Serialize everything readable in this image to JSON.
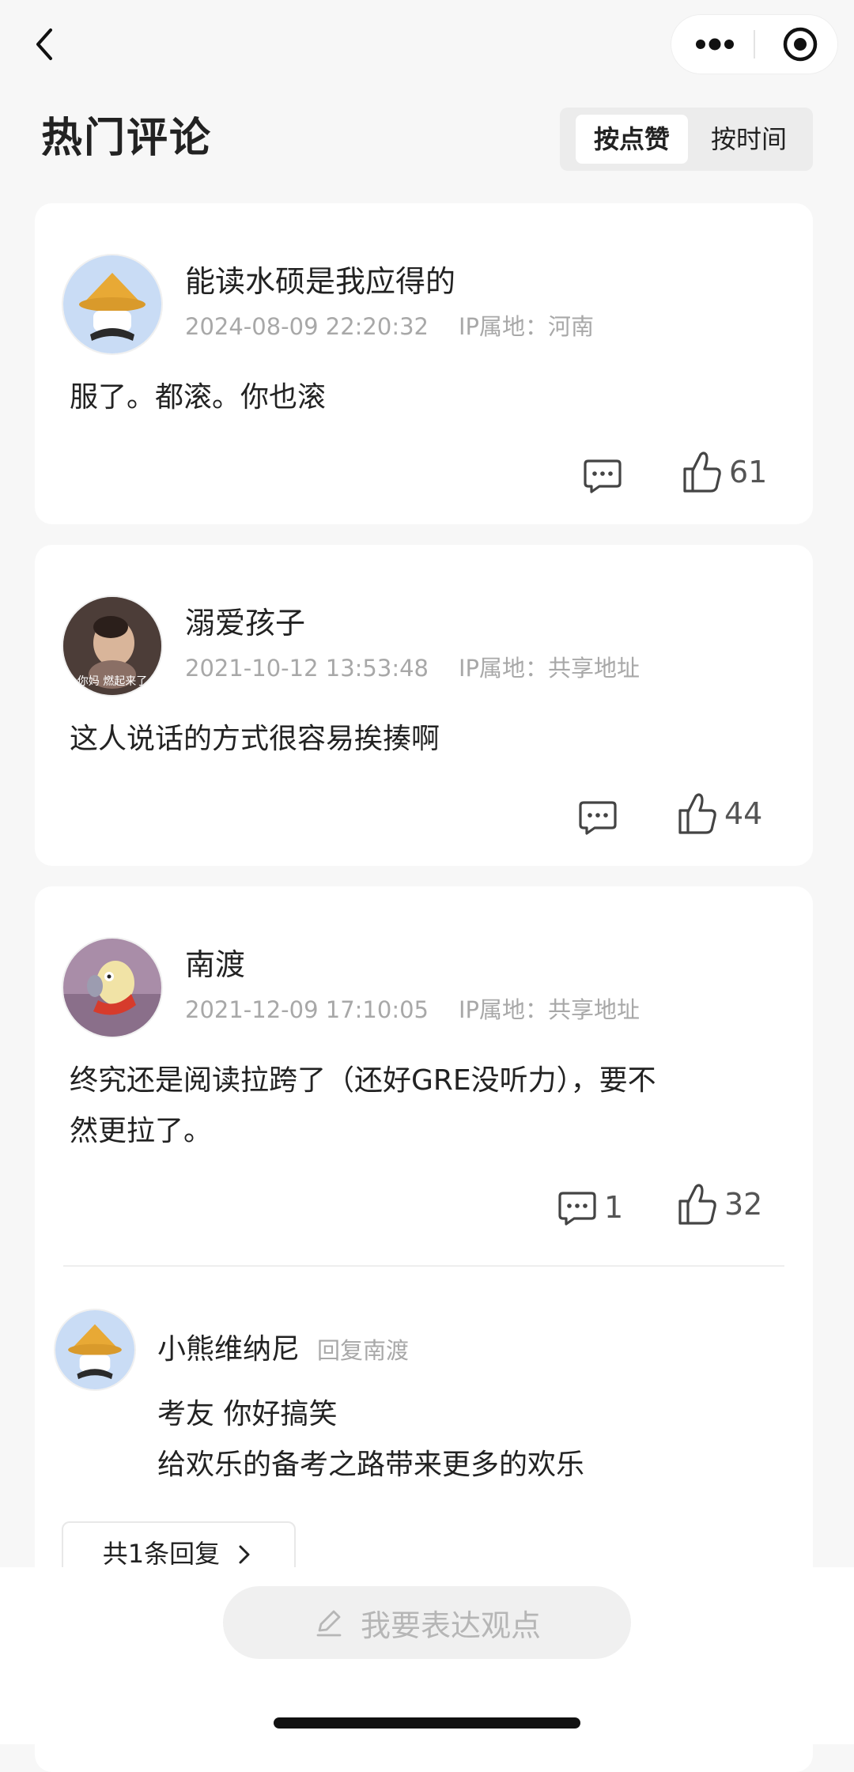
{
  "header": {
    "back_icon": "chevron-left-icon",
    "more_icon": "more-dots-icon",
    "close_icon": "target-close-icon"
  },
  "title": "热门评论",
  "sort": {
    "by_likes": "按点赞",
    "by_time": "按时间",
    "selected": "按点赞"
  },
  "comments": [
    {
      "user": "能读水硕是我应得的",
      "time": "2024-08-09 22:20:32",
      "ip": "IP属地：河南",
      "text": "服了。都滚。你也滚",
      "likes": "61",
      "replies": ""
    },
    {
      "user": "溺爱孩子",
      "time": "2021-10-12 13:53:48",
      "ip": "IP属地：共享地址",
      "text": "这人说话的方式很容易挨揍啊",
      "likes": "44",
      "replies": "",
      "avatar_caption": "你妈 燃起来了"
    },
    {
      "user": "南渡",
      "time": "2021-12-09 17:10:05",
      "ip": "IP属地：共享地址",
      "text_line1": "终究还是阅读拉跨了（还好GRE没听力），要不",
      "text_line2": "然更拉了。",
      "likes": "32",
      "replies": "1",
      "reply": {
        "user": "小熊维纳尼",
        "reply_to": "回复南渡",
        "line1": "考友 你好搞笑",
        "line2": "给欢乐的备考之路带来更多的欢乐"
      },
      "more_replies": "共1条回复"
    }
  ],
  "footer": {
    "express": "我要表达观点",
    "edit_icon": "edit-pencil-icon"
  },
  "colors": {
    "background": "#f7f7f7",
    "card": "#ffffff",
    "muted": "#a8a8a8"
  }
}
